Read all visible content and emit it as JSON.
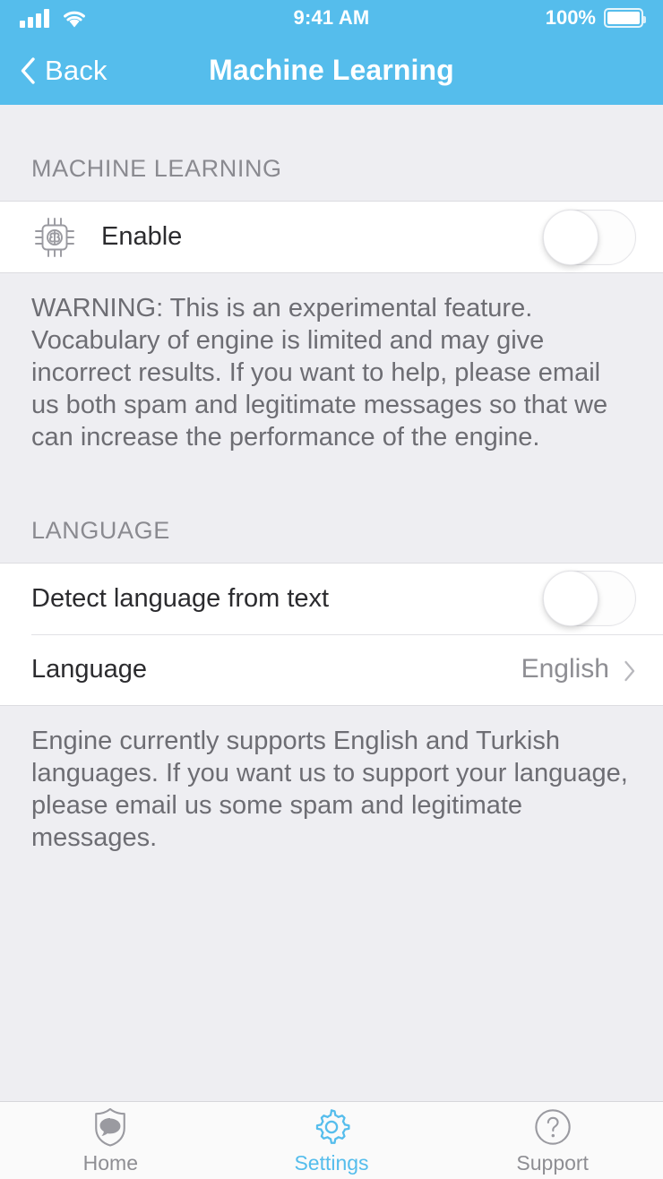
{
  "statusbar": {
    "time": "9:41 AM",
    "battery_percent": "100%",
    "signal_icon": "signal-bars-icon",
    "wifi_icon": "wifi-icon",
    "battery_icon": "battery-full-icon"
  },
  "navbar": {
    "back_label": "Back",
    "back_icon": "chevron-left-icon",
    "title": "Machine Learning"
  },
  "sections": {
    "machine_learning": {
      "header": "MACHINE LEARNING",
      "enable_row": {
        "icon": "cpu-brain-chip-icon",
        "label": "Enable",
        "toggle_state": "off"
      },
      "note": "WARNING: This is an experimental feature. Vocabulary of engine is limited and may give incorrect results. If you want to help, please email us both spam and legitimate messages so that we can increase the performance of the engine."
    },
    "language": {
      "header": "LANGUAGE",
      "detect_row": {
        "label": "Detect language from text",
        "toggle_state": "off"
      },
      "language_row": {
        "label": "Language",
        "value": "English",
        "chevron_icon": "chevron-right-icon"
      },
      "note": "Engine currently supports English and Turkish languages. If you want us to support your language, please email us some spam and legitimate messages."
    }
  },
  "tabbar": {
    "tabs": [
      {
        "label": "Home",
        "icon": "shield-chat-icon",
        "active": false
      },
      {
        "label": "Settings",
        "icon": "gear-icon",
        "active": true
      },
      {
        "label": "Support",
        "icon": "question-circle-icon",
        "active": false
      }
    ]
  },
  "colors": {
    "accent": "#55bdec",
    "page_bg": "#eeeef2",
    "card_bg": "#ffffff",
    "muted_text": "#8e8e93"
  }
}
